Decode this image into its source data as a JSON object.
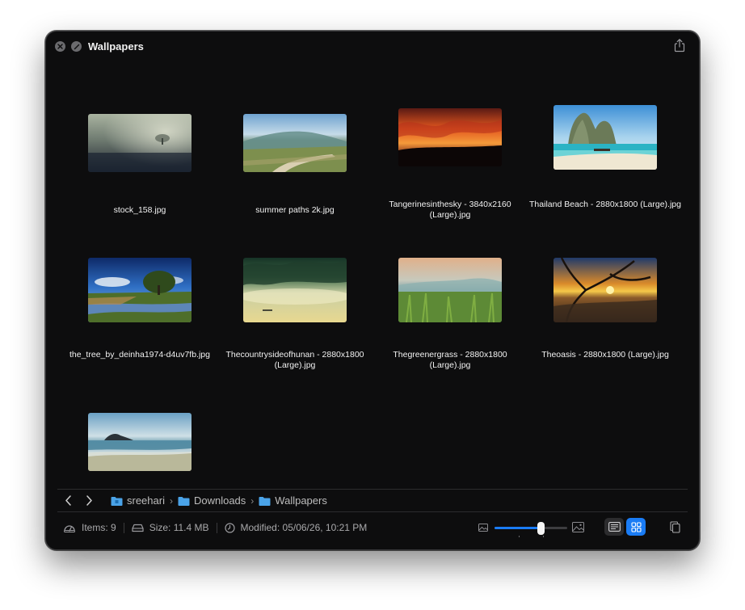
{
  "window": {
    "title": "Wallpapers"
  },
  "items": [
    {
      "name": "stock_158.jpg",
      "image": "foggy-tree-dark"
    },
    {
      "name": "summer paths 2k.jpg",
      "image": "green-hills-path"
    },
    {
      "name": "Tangerinesinthesky - 3840x2160 (Large).jpg",
      "image": "orange-sunset-clouds"
    },
    {
      "name": "Thailand Beach - 2880x1800 (Large).jpg",
      "image": "tropical-beach-cliffs"
    },
    {
      "name": "the_tree_by_deinha1974-d4uv7fb.jpg",
      "image": "tree-stream-blue-sky"
    },
    {
      "name": "Thecountrysideofhunan - 2880x1800 (Large).jpg",
      "image": "misty-lake-boat"
    },
    {
      "name": "Thegreenergrass - 2880x1800 (Large).jpg",
      "image": "grass-hazy-sky"
    },
    {
      "name": "Theoasis - 2880x1800 (Large).jpg",
      "image": "sunset-tree-lake"
    },
    {
      "name": "",
      "image": "coastal-rock-sea"
    }
  ],
  "path": {
    "crumbs": [
      "sreehari",
      "Downloads",
      "Wallpapers"
    ],
    "separator": "›"
  },
  "status": {
    "items": "Items: 9",
    "size": "Size: 11.4 MB",
    "modified": "Modified: 05/06/26, 10:21 PM",
    "zoom_fraction": 0.63
  },
  "colors": {
    "accent": "#1a7cf5",
    "folder": "#4aa3e8"
  }
}
